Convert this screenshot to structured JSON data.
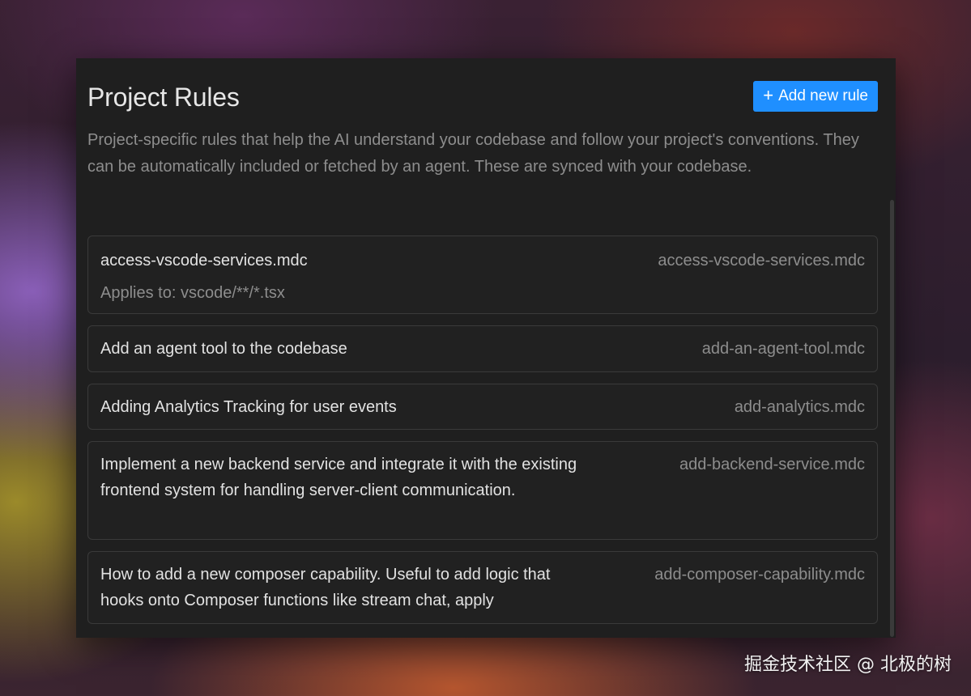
{
  "header": {
    "title": "Project Rules",
    "add_button_label": "Add new rule",
    "add_button_icon": "plus-icon",
    "accent_color": "#1f8fff"
  },
  "description": "Project-specific rules that help the AI understand your codebase and follow your project's conventions. They can be automatically included or fetched by an agent. These are synced with your codebase.",
  "rules": [
    {
      "name": "access-vscode-services.mdc",
      "applies_to": "Applies to: vscode/**/*.tsx",
      "file": "access-vscode-services.mdc"
    },
    {
      "name": "Add an agent tool to the codebase",
      "file": "add-an-agent-tool.mdc"
    },
    {
      "name": "Adding Analytics Tracking for user events",
      "file": "add-analytics.mdc"
    },
    {
      "name": "Implement a new backend service and integrate it with the existing frontend system for handling server-client communication.",
      "file": "add-backend-service.mdc"
    },
    {
      "name": "How to add a new composer capability. Useful to add logic that hooks onto Composer functions like stream chat, apply",
      "file": "add-composer-capability.mdc"
    }
  ],
  "watermark": "掘金技术社区 @ 北极的树"
}
